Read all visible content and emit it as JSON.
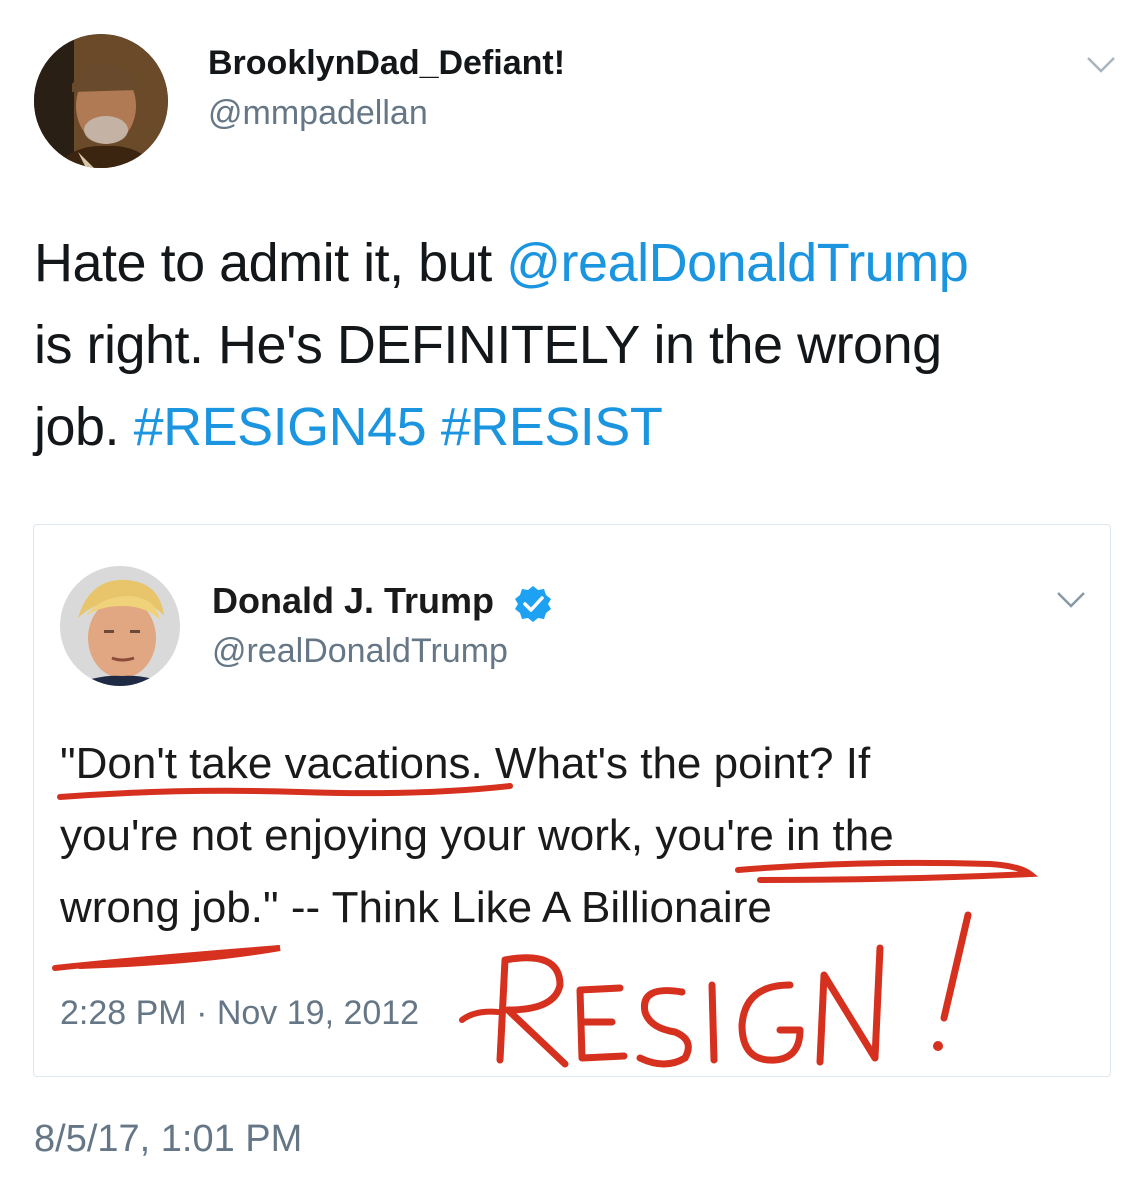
{
  "author": {
    "display_name": "BrooklynDad_Defiant!",
    "handle": "@mmpadellan"
  },
  "tweet": {
    "line1_pre": "Hate to admit it, but ",
    "line1_mention": "@realDonaldTrump",
    "line2": "is right. He's DEFINITELY in the wrong",
    "line3_pre": "job. ",
    "hashtag1": "#RESIGN45",
    "hashtag2": "#RESIST",
    "timestamp": "8/5/17, 1:01 PM"
  },
  "quoted": {
    "display_name": "Donald J. Trump",
    "handle": "@realDonaldTrump",
    "line1": "\"Don't take vacations.  What's the point?  If",
    "line2": "you're not enjoying your work, you're in the",
    "line3": "wrong job.\"  -- Think Like A Billionaire",
    "timestamp": "2:28 PM · Nov 19, 2012"
  },
  "annotation": {
    "handwritten_text": "RESIGN!",
    "color": "#d6301f"
  },
  "colors": {
    "link": "#1b95e0",
    "verified": "#1da1f2",
    "muted": "#657786"
  },
  "icons": [
    "chevron-down-icon",
    "verified-badge-icon"
  ]
}
